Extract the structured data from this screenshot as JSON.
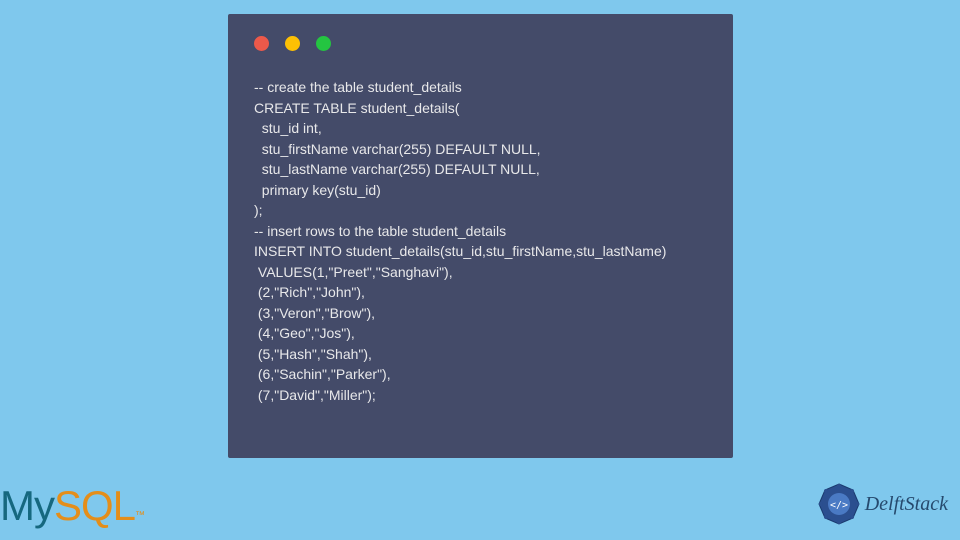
{
  "code": {
    "lines": [
      "-- create the table student_details",
      "CREATE TABLE student_details(",
      "  stu_id int,",
      "  stu_firstName varchar(255) DEFAULT NULL,",
      "  stu_lastName varchar(255) DEFAULT NULL,",
      "  primary key(stu_id)",
      ");",
      "-- insert rows to the table student_details",
      "INSERT INTO student_details(stu_id,stu_firstName,stu_lastName)",
      " VALUES(1,\"Preet\",\"Sanghavi\"),",
      " (2,\"Rich\",\"John\"),",
      " (3,\"Veron\",\"Brow\"),",
      " (4,\"Geo\",\"Jos\"),",
      " (5,\"Hash\",\"Shah\"),",
      " (6,\"Sachin\",\"Parker\"),",
      " (7,\"David\",\"Miller\");"
    ]
  },
  "logos": {
    "mysql_my": "My",
    "mysql_sql": "SQL",
    "mysql_tm": "™",
    "delftstack": "DelftStack"
  }
}
